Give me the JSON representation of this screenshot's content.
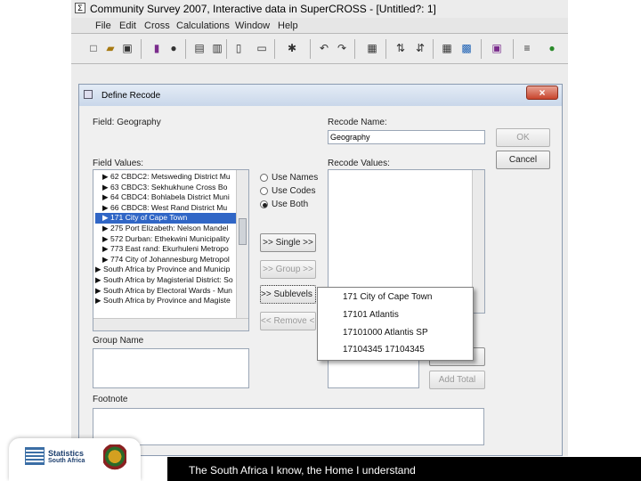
{
  "app": {
    "title": "Community Survey 2007, Interactive data in SuperCROSS - [Untitled?: 1]",
    "menu": [
      "File",
      "Edit",
      "Cross",
      "Calculations",
      "Window",
      "Help"
    ]
  },
  "dialog": {
    "title": "Define Recode",
    "field_label": "Field: Geography",
    "field_values_label": "Field Values:",
    "recode_name_label": "Recode Name:",
    "recode_name_value": "Geography",
    "recode_values_label": "Recode Values:",
    "group_name_label": "Group Name",
    "footnote_label": "Footnote",
    "ok_label": "OK",
    "cancel_label": "Cancel",
    "add_total_label": "Add Total",
    "radio_options": [
      {
        "label": "Use Names",
        "selected": false
      },
      {
        "label": "Use Codes",
        "selected": false
      },
      {
        "label": "Use Both",
        "selected": true
      }
    ],
    "buttons": {
      "single": ">> Single >>",
      "group": ">> Group >>",
      "sublevels": ">> Sublevels >>",
      "remove": "<< Remove <<"
    },
    "field_values": [
      {
        "text": "▶ 62 CBDC2: Metsweding District Mu",
        "selected": false
      },
      {
        "text": "▶ 63 CBDC3: Sekhukhune Cross Bo",
        "selected": false
      },
      {
        "text": "▶ 64 CBDC4: Bohlabela District Muni",
        "selected": false
      },
      {
        "text": "▶ 66 CBDC8: West Rand District Mu",
        "selected": false
      },
      {
        "text": "▶ 171 City of Cape Town",
        "selected": true
      },
      {
        "text": "▶ 275 Port Elizabeth: Nelson Mandel",
        "selected": false
      },
      {
        "text": "▶ 572 Durban: Ethekwini Municipality",
        "selected": false
      },
      {
        "text": "▶ 773 East rand: Ekurhuleni Metropo",
        "selected": false
      },
      {
        "text": "▶ 774 City of Johannesburg Metropol",
        "selected": false
      },
      {
        "text": "▶ South Africa by Province and Municip",
        "selected": false
      },
      {
        "text": "▶ South Africa by Magisterial District: So",
        "selected": false
      },
      {
        "text": "▶ South Africa by Electoral Wards - Mun",
        "selected": false
      },
      {
        "text": "▶ South Africa by Province and Magiste",
        "selected": false
      }
    ]
  },
  "popup": {
    "items": [
      "171 City of Cape Town",
      "17101 Atlantis",
      "17101000 Atlantis SP",
      "17104345 17104345"
    ]
  },
  "footer": {
    "tagline": "The South Africa I know, the Home I understand",
    "logo_line1": "Statistics",
    "logo_line2": "South Africa"
  }
}
